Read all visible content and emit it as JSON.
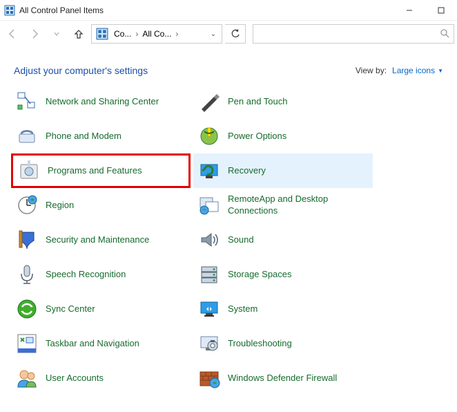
{
  "window": {
    "title": "All Control Panel Items"
  },
  "address": {
    "crumb1": "Co...",
    "crumb2": "All Co..."
  },
  "heading": {
    "text": "Adjust your computer's settings"
  },
  "viewby": {
    "label": "View by:",
    "mode": "Large icons"
  },
  "items": [
    {
      "label": "Network and Sharing Center"
    },
    {
      "label": "Pen and Touch"
    },
    {
      "label": "Phone and Modem"
    },
    {
      "label": "Power Options"
    },
    {
      "label": "Programs and Features"
    },
    {
      "label": "Recovery"
    },
    {
      "label": "Region"
    },
    {
      "label": "RemoteApp and Desktop Connections"
    },
    {
      "label": "Security and Maintenance"
    },
    {
      "label": "Sound"
    },
    {
      "label": "Speech Recognition"
    },
    {
      "label": "Storage Spaces"
    },
    {
      "label": "Sync Center"
    },
    {
      "label": "System"
    },
    {
      "label": "Taskbar and Navigation"
    },
    {
      "label": "Troubleshooting"
    },
    {
      "label": "User Accounts"
    },
    {
      "label": "Windows Defender Firewall"
    }
  ]
}
